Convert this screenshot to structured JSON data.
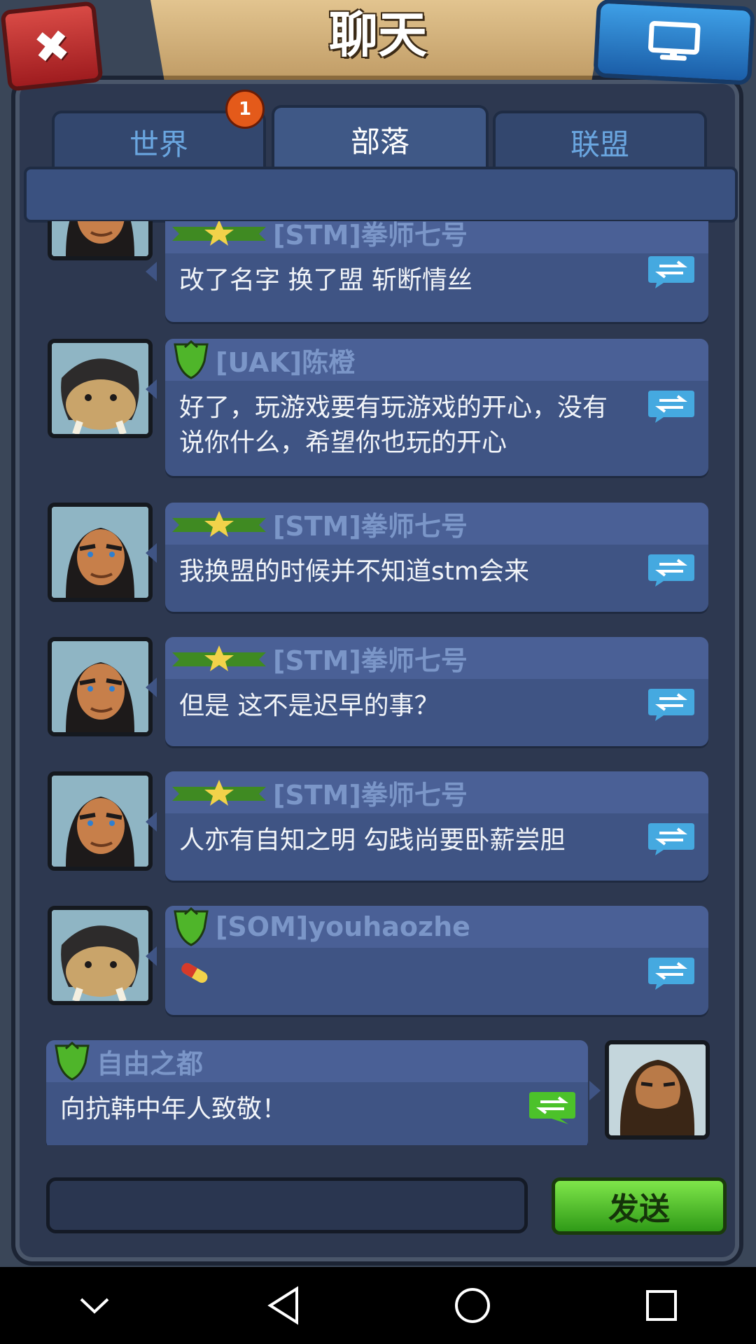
{
  "header": {
    "title": "聊天"
  },
  "tabs": [
    {
      "label": "世界",
      "badge": "1"
    },
    {
      "label": "部落",
      "active": true
    },
    {
      "label": "联盟"
    }
  ],
  "messages": [
    {
      "sender": "[STM]拳师七号",
      "text": "改了名字 换了盟 斩断情丝",
      "rank": "star",
      "avatar": "warrior"
    },
    {
      "sender": "[UAK]陈橙",
      "text": "好了，玩游戏要有玩游戏的开心，没有说你什么，希望你也玩的开心",
      "rank": "shield",
      "avatar": "boar"
    },
    {
      "sender": "[STM]拳师七号",
      "text": "我换盟的时候并不知道stm会来",
      "rank": "star",
      "avatar": "warrior"
    },
    {
      "sender": "[STM]拳师七号",
      "text": "但是 这不是迟早的事？",
      "rank": "star",
      "avatar": "warrior"
    },
    {
      "sender": "[STM]拳师七号",
      "text": "人亦有自知之明 勾践尚要卧薪尝胆",
      "rank": "star",
      "avatar": "warrior"
    },
    {
      "sender": "[SOM]youhaozhe",
      "text": "",
      "rank": "shield",
      "avatar": "boar",
      "emoji": "pill"
    }
  ],
  "own_message": {
    "sender": "自由之都",
    "text": "向抗韩中年人致敬！",
    "rank": "shield"
  },
  "input": {
    "placeholder": ""
  },
  "send_label": "发送",
  "colors": {
    "send": "#4cc22a",
    "close": "#c23330",
    "screen": "#2a78c8"
  }
}
